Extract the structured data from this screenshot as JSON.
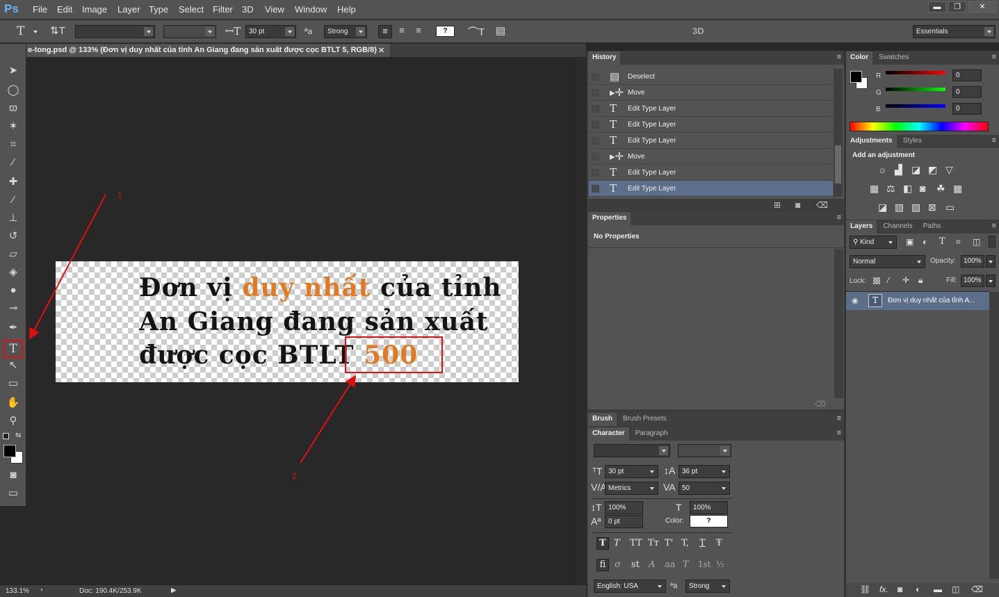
{
  "app": {
    "logo": "Ps"
  },
  "menu": [
    "File",
    "Edit",
    "Image",
    "Layer",
    "Type",
    "Select",
    "Filter",
    "3D",
    "View",
    "Window",
    "Help"
  ],
  "window_controls": {
    "minimize": "▬",
    "restore": "❐",
    "close": "✕"
  },
  "options_bar": {
    "font_size": "30 pt",
    "antialias_icon": "aa",
    "antialias": "Strong",
    "color_swatch": "?",
    "threed": "3D",
    "workspace": "Essentials"
  },
  "document": {
    "tab_title": "e-tong.psd @ 133% (Đơn vị duy nhất của tỉnh An Giang đang sản xuất được cọc BTLT 5, RGB/8)",
    "tab_close": "✕",
    "line1_a": "Đơn vị ",
    "line1_b": "duy nhất",
    "line1_c": " của tỉnh",
    "line2": "An Giang đang sản xuất",
    "line3_a": "được cọc BTLT ",
    "line3_b": "500"
  },
  "annotations": {
    "label1": "1",
    "label2": "2"
  },
  "status": {
    "zoom": "133.1%",
    "doc": "Doc: 190.4K/253.9K"
  },
  "history": {
    "title": "History",
    "items": [
      {
        "icon": "doc",
        "label": "Deselect"
      },
      {
        "icon": "move",
        "label": "Move"
      },
      {
        "icon": "T",
        "label": "Edit Type Layer"
      },
      {
        "icon": "T",
        "label": "Edit Type Layer"
      },
      {
        "icon": "T",
        "label": "Edit Type Layer"
      },
      {
        "icon": "move",
        "label": "Move"
      },
      {
        "icon": "T",
        "label": "Edit Type Layer"
      },
      {
        "icon": "T",
        "label": "Edit Type Layer"
      }
    ]
  },
  "properties": {
    "title": "Properties",
    "message": "No Properties"
  },
  "brush_tabs": [
    "Brush",
    "Brush Presets"
  ],
  "character": {
    "tabs": [
      "Character",
      "Paragraph"
    ],
    "size": "30 pt",
    "leading": "36 pt",
    "kerning": "Metrics",
    "tracking": "50",
    "vscale": "100%",
    "hscale": "100%",
    "baseline": "0 pt",
    "color_label": "Color:",
    "color_value": "?",
    "language": "English: USA",
    "aa": "Strong",
    "style_btns": [
      "T",
      "T",
      "TT",
      "Tт",
      "T'",
      "T,",
      "T",
      "Ŧ"
    ],
    "ot_btns": [
      "fi",
      "σ",
      "st",
      "A",
      "aa",
      "T",
      "1st",
      "½"
    ]
  },
  "color": {
    "tabs": [
      "Color",
      "Swatches"
    ],
    "r_label": "R",
    "g_label": "G",
    "b_label": "B",
    "r": "0",
    "g": "0",
    "b": "0"
  },
  "adjustments": {
    "tabs": [
      "Adjustments",
      "Styles"
    ],
    "heading": "Add an adjustment"
  },
  "layers": {
    "tabs": [
      "Layers",
      "Channels",
      "Paths"
    ],
    "kind": "Kind",
    "blend": "Normal",
    "opacity_label": "Opacity:",
    "opacity": "100%",
    "lock_label": "Lock:",
    "fill_label": "Fill:",
    "fill": "100%",
    "layer_name": "Đơn vị duy nhất của tỉnh A...",
    "layer_icon": "T"
  }
}
